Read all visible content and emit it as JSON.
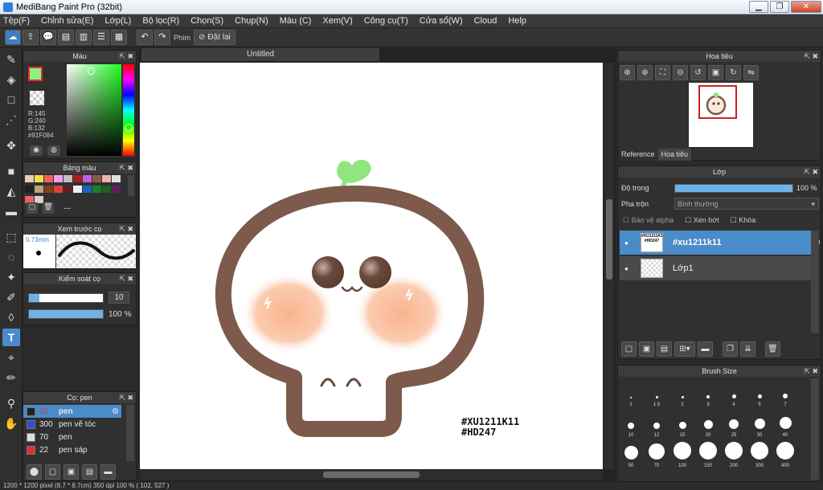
{
  "window": {
    "title": "MediBang Paint Pro (32bit)"
  },
  "menu": [
    "Tệp(F)",
    "Chỉnh sửa(E)",
    "Lớp(L)",
    "Bộ lọc(R)",
    "Chọn(S)",
    "Chụp(N)",
    "Màu (C)",
    "Xem(V)",
    "Công cụ(T)",
    "Cửa sổ(W)",
    "Cloud",
    "Help"
  ],
  "toolbar": {
    "hotkey_label": "Phím",
    "reset_label": "Đặt lại"
  },
  "color_panel": {
    "title": "Màu",
    "r": "R:145",
    "g": "G:240",
    "b": "B:132",
    "hex": "#91F084",
    "foreground": "#91f084"
  },
  "palette_panel": {
    "title": "Bảng màu",
    "dash": "---",
    "colors": [
      "#e0d0c0",
      "#f0e040",
      "#f06060",
      "#f0a0f0",
      "#c0c0c0",
      "#a02020",
      "#c060e0",
      "#806040",
      "#f0b0b0",
      "#e0e0e0",
      "#202020",
      "#c0a080",
      "#804020",
      "#e04040",
      "#602020",
      "#f0f0f0",
      "#2060c0",
      "#208020",
      "#206020",
      "#602060",
      "#f06060",
      "#d0d0d0"
    ]
  },
  "brush_preview": {
    "title": "Xem trước cọ",
    "size": "0.73mm"
  },
  "brush_control": {
    "title": "Kiểm soát cọ",
    "size_value": "10",
    "size_fill": 0.14,
    "opacity_value": "100 %",
    "opacity_fill": 1.0
  },
  "brush_list": {
    "title": "Cọ: pen",
    "items": [
      {
        "size": "10",
        "name": "pen",
        "color": "#222222",
        "selected": true
      },
      {
        "size": "300",
        "name": "pen vẽ tóc",
        "color": "#3050d0",
        "selected": false
      },
      {
        "size": "70",
        "name": "pen",
        "color": "#dddddd",
        "selected": false
      },
      {
        "size": "22",
        "name": "pen sáp",
        "color": "#e03030",
        "selected": false
      }
    ]
  },
  "document": {
    "tab": "Untitled"
  },
  "artwork": {
    "watermark_line1": "#XU1211K11",
    "watermark_line2": "#HD247"
  },
  "navigator": {
    "title": "Hoa tiêu",
    "tab_reference": "Reference",
    "tab_navigator": "Hoa tiêu"
  },
  "layers": {
    "title": "Lớp",
    "opacity_label": "Độ trong",
    "opacity_value": "100 %",
    "opacity_fill": 1.0,
    "blend_label": "Pha trộn",
    "blend_value": "Bình thường",
    "protect_alpha": "Bảo vệ alpha",
    "clipping": "Xén bớt",
    "lock": "Khóa",
    "items": [
      {
        "name": "#xu1211k11",
        "thumb": "#XU1211K11 #HD247",
        "selected": true
      },
      {
        "name": "Lớp1",
        "thumb": "",
        "selected": false
      }
    ]
  },
  "brush_size": {
    "title": "Brush Size",
    "sizes": [
      "1",
      "1.5",
      "2",
      "3",
      "4",
      "5",
      "7",
      "10",
      "12",
      "15",
      "20",
      "25",
      "30",
      "40",
      "50",
      "70",
      "100",
      "150",
      "200",
      "300",
      "400"
    ]
  },
  "status": {
    "text": "1200 * 1200 pixel   (8.7 * 8.7cm)   350 dpi   100 %   ( 102, 527 )"
  }
}
